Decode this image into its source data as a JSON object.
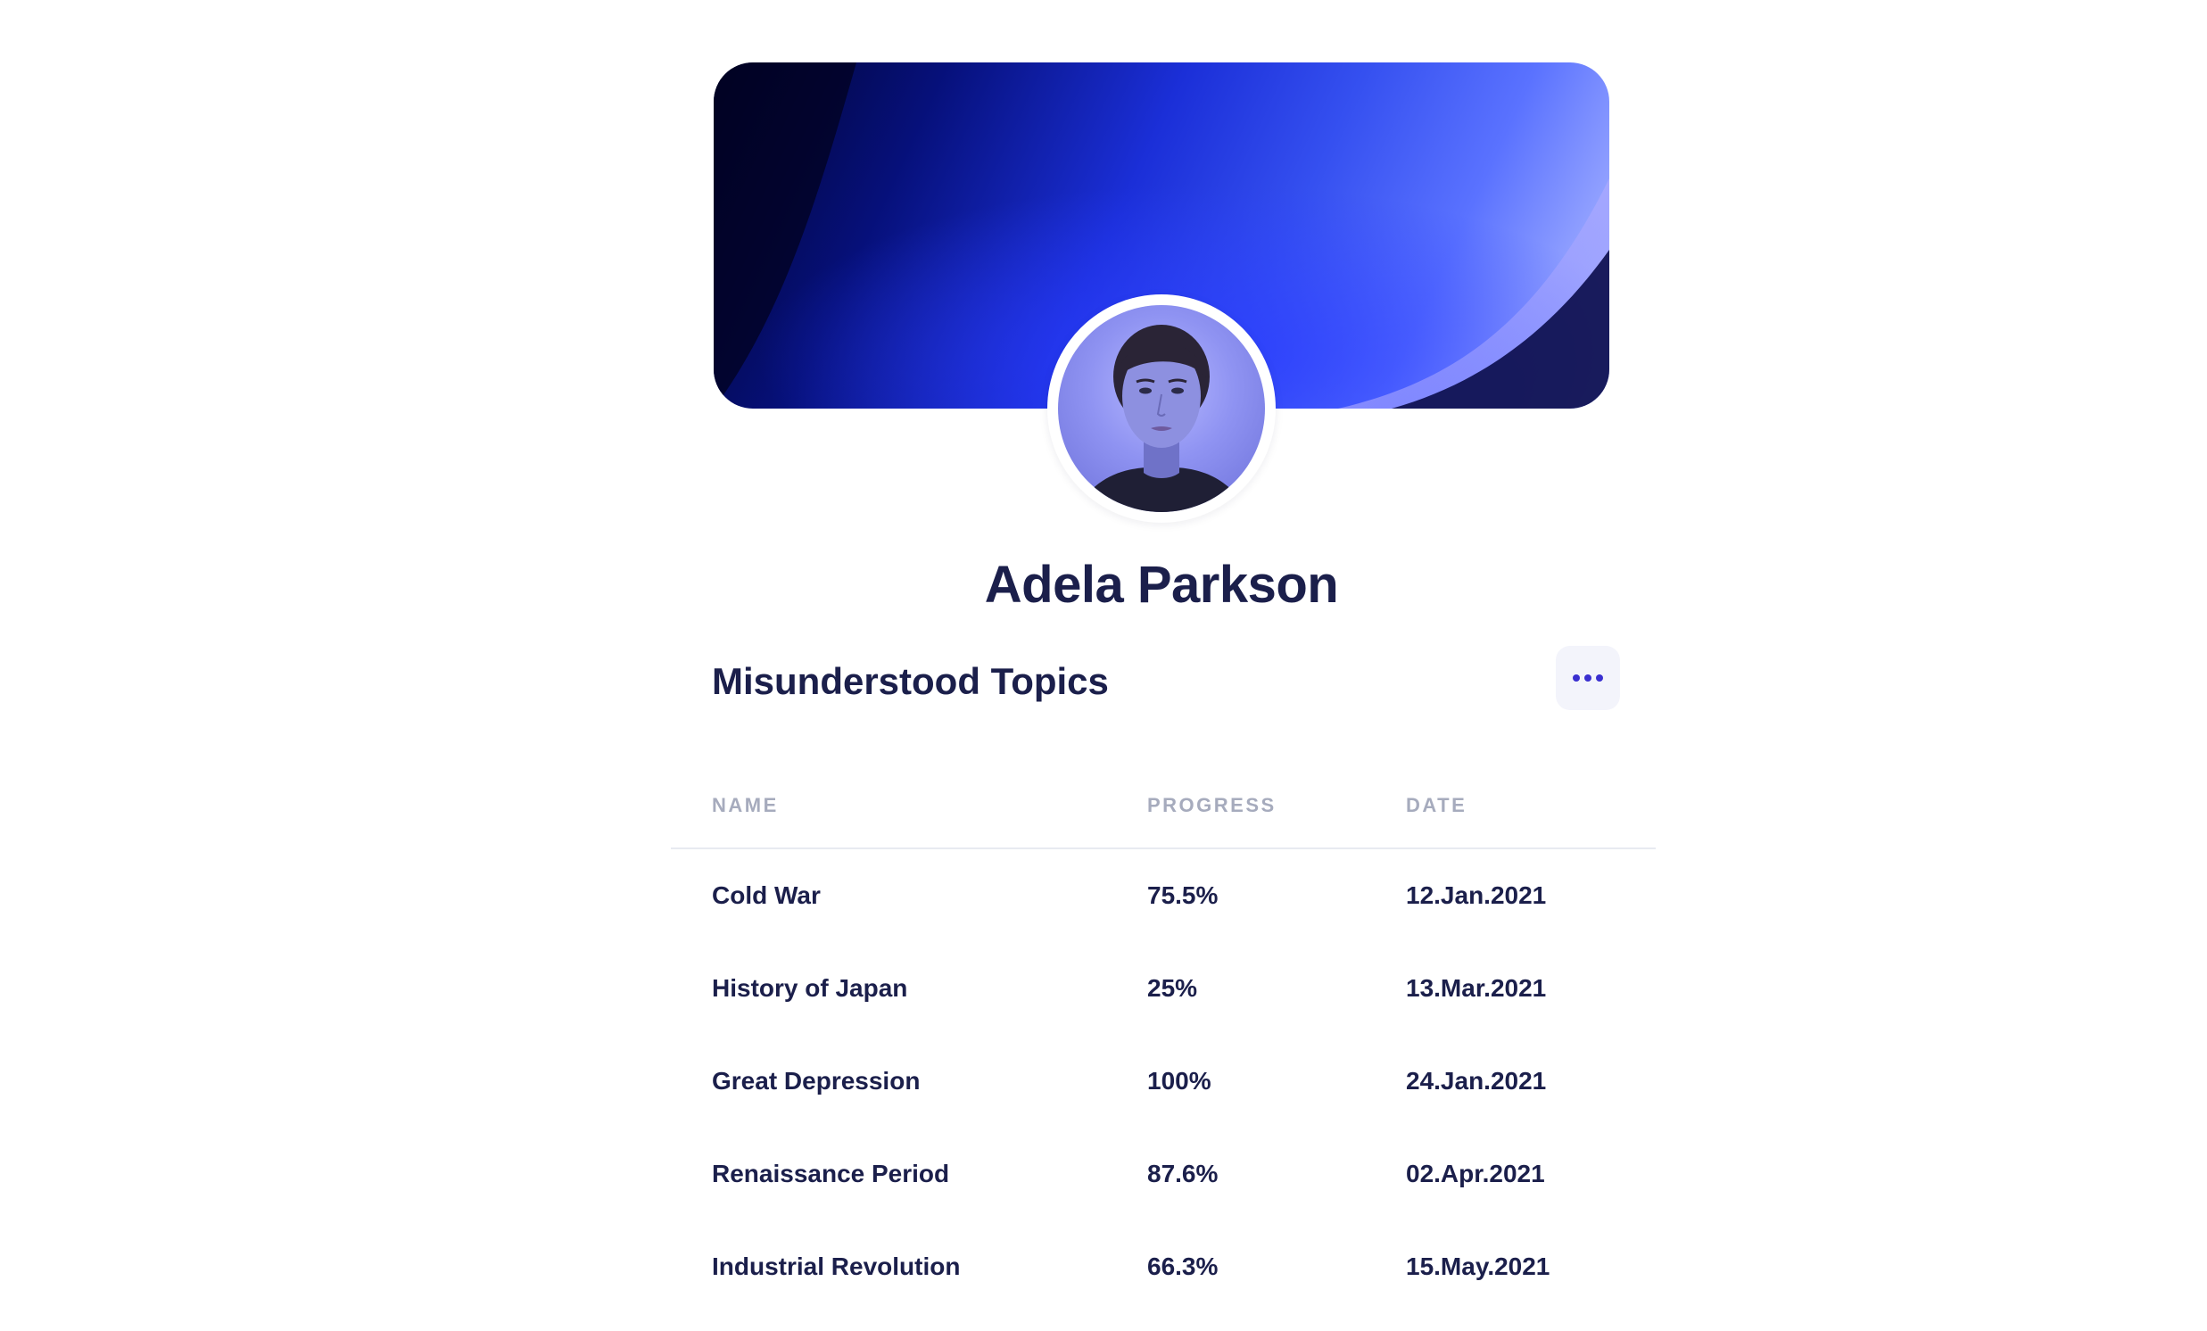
{
  "profile": {
    "name": "Adela Parkson"
  },
  "section": {
    "title": "Misunderstood Topics",
    "more_icon": "more-horizontal-icon"
  },
  "table": {
    "headers": {
      "name": "NAME",
      "progress": "PROGRESS",
      "date": "DATE"
    },
    "rows": [
      {
        "name": "Cold War",
        "progress": "75.5%",
        "date": "12.Jan.2021"
      },
      {
        "name": "History of Japan",
        "progress": "25%",
        "date": "13.Mar.2021"
      },
      {
        "name": "Great Depression",
        "progress": "100%",
        "date": "24.Jan.2021"
      },
      {
        "name": "Renaissance Period",
        "progress": "87.6%",
        "date": "02.Apr.2021"
      },
      {
        "name": "Industrial Revolution",
        "progress": "66.3%",
        "date": "15.May.2021"
      }
    ]
  },
  "colors": {
    "text_primary": "#1b1f4b",
    "text_muted": "#a6abbd",
    "accent": "#3a2fd0",
    "button_bg": "#f3f4fb"
  }
}
